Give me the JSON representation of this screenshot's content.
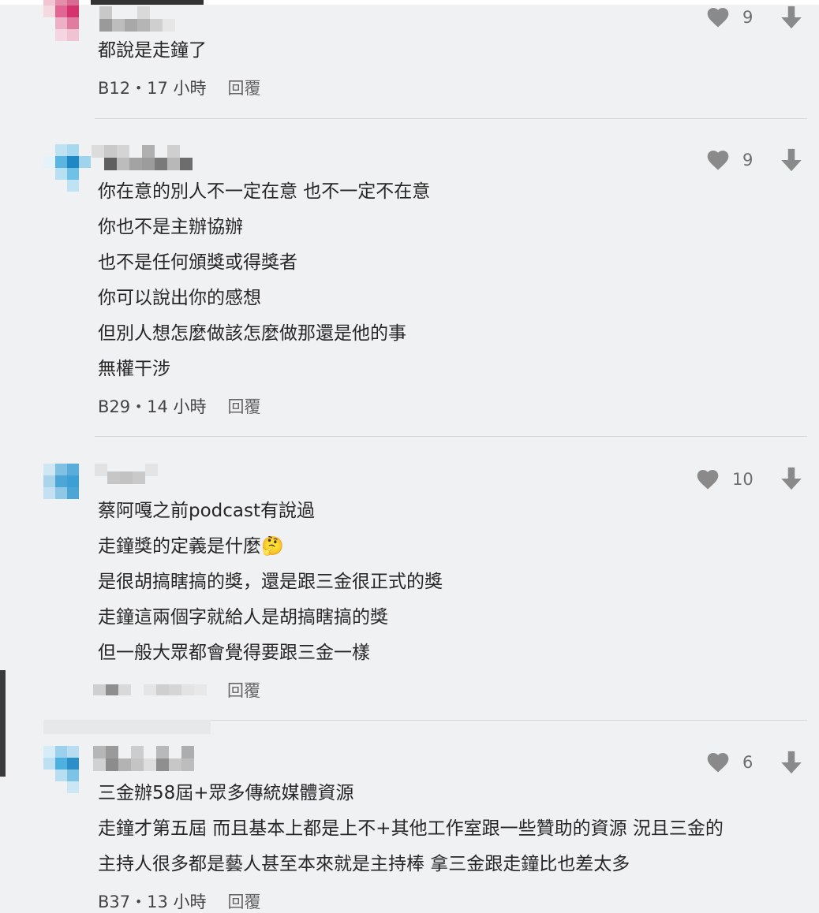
{
  "colors": {
    "background": "#f0f1f3",
    "text": "#262626",
    "icon": "#8a8a8a",
    "divider": "#d6d6d6"
  },
  "icons": {
    "like": "heart-icon",
    "dislike": "arrow-down-icon"
  },
  "comments": [
    {
      "likes": "9",
      "lines": [
        "都說是走鐘了"
      ],
      "time": "B12・17 小時",
      "reply": "回覆"
    },
    {
      "likes": "9",
      "lines": [
        "你在意的別人不一定在意 也不一定不在意",
        "你也不是主辦協辦",
        "也不是任何頒獎或得獎者",
        "你可以說出你的感想",
        "但別人想怎麼做該怎麼做那還是他的事",
        "無權干涉"
      ],
      "time": "B29・14 小時",
      "reply": "回覆"
    },
    {
      "likes": "10",
      "lines": [
        "蔡阿嘎之前podcast有說過",
        "走鐘獎的定義是什麼🤔",
        "是很胡搞瞎搞的獎，還是跟三金很正式的獎",
        "走鐘這兩個字就給人是胡搞瞎搞的獎",
        "但一般大眾都會覺得要跟三金一樣"
      ],
      "reply": "回覆"
    },
    {
      "likes": "6",
      "lines": [
        "三金辦58屆+眾多傳統媒體資源",
        "走鐘才第五屆  而且基本上都是上不+其他工作室跟一些贊助的資源  況且三金的",
        "主持人很多都是藝人甚至本來就是主持棒 拿三金跟走鐘比也差太多"
      ],
      "time": "B37・13 小時",
      "reply": "回覆"
    }
  ]
}
